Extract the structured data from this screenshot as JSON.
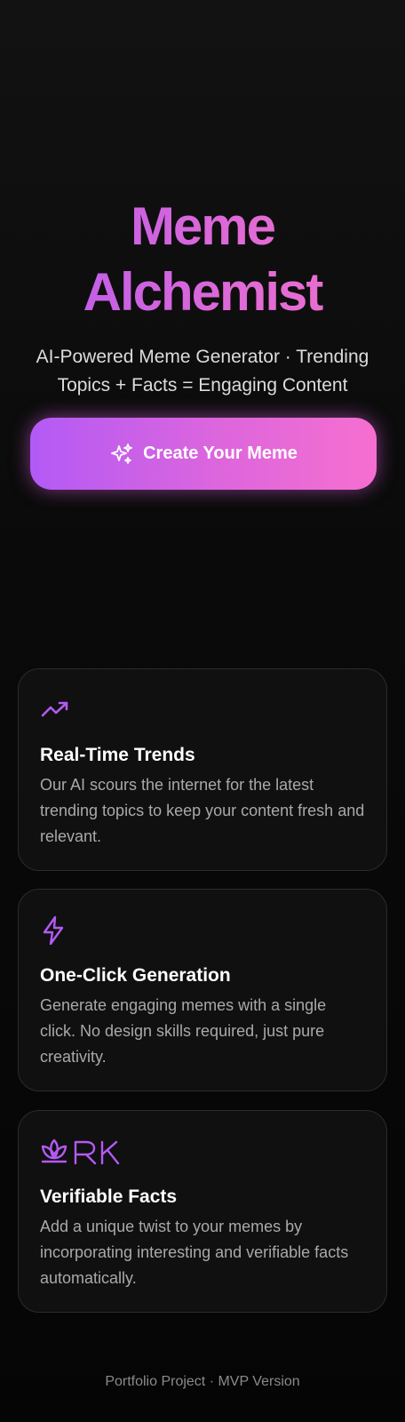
{
  "hero": {
    "title_line1": "Meme",
    "title_line2": "Alchemist",
    "subtitle": "AI-Powered Meme Generator · Trending Topics + Facts = Engaging Content",
    "cta_label": "Create Your Meme",
    "cta_icon": "sparkles-icon"
  },
  "features": [
    {
      "icon": "trending-up-icon",
      "title": "Real-Time Trends",
      "description": "Our AI scours the internet for the latest trending topics to keep your content fresh and relevant."
    },
    {
      "icon": "lightning-bolt-icon",
      "title": "One-Click Generation",
      "description": "Generate engaging memes with a single click. No design skills required, just pure creativity."
    },
    {
      "icon": "lotus-icon",
      "icon_text": "RK",
      "title": "Verifiable Facts",
      "description": "Add a unique twist to your memes by incorporating interesting and verifiable facts automatically."
    }
  ],
  "footer": {
    "text": "Portfolio Project · MVP Version"
  },
  "colors": {
    "accent_purple": "#b35af5",
    "accent_pink": "#f66fd0",
    "background": "#0a0a0a",
    "card_background": "#101010",
    "card_border": "#2b2b2b"
  }
}
